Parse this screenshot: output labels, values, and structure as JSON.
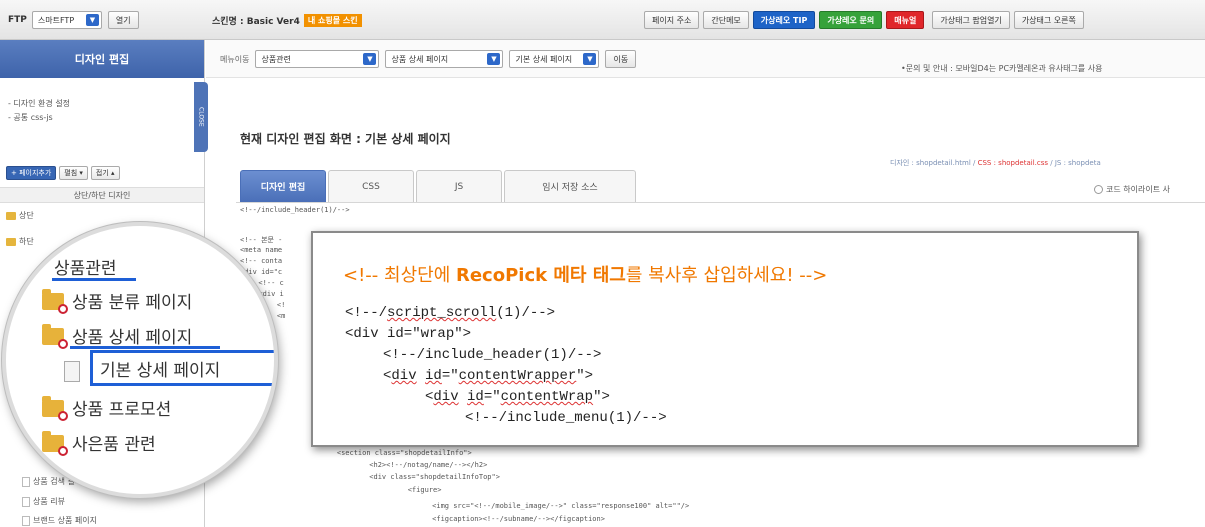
{
  "topbar": {
    "ftp_label": "FTP",
    "ftp_select": "스마트FTP",
    "open_button": "열기",
    "skin_label": "스킨명 : Basic Ver4",
    "skin_badge": "내 쇼핑몰 스킨",
    "buttons": [
      "페이지 주소",
      "간단메모"
    ],
    "tip_button": "가상레오 TIP",
    "inquiry_button": "가상레오 문의",
    "manual_button": "매뉴얼",
    "popup_open_button": "가상태그 팝업열기",
    "right_button": "가상태그 오른쪽"
  },
  "leftpanel": {
    "title": "디자인 편집",
    "links": [
      "- 디자인 환경 설정",
      "- 공통 css-js"
    ],
    "close_tab": "CLOSE",
    "tools": [
      "+ 페이지추가",
      "펼침 ▾",
      "접기 ▴"
    ],
    "section": "상단/하단 디자인",
    "tree": [
      "상단",
      "하단",
      "상품 검색 결과 화면",
      "상품 리뷰",
      "브랜드 상품 페이지"
    ]
  },
  "subbar": {
    "menu_label": "메뉴이동",
    "select1": "상품관련",
    "select2": "상품 상세 페이지",
    "select3": "기본 상세 페이지",
    "move_button": "이동",
    "notice": "•문의 및 안내 : 모바일D4는 PC카멜레온과 유사태그를 사용"
  },
  "main": {
    "heading": "현재 디자인 편집 화면 : 기본 상세 페이지",
    "file_info": {
      "design": "디자인 : shopdetail.html / ",
      "css": "CSS : shopdetail.css",
      "js": " / JS : shopdeta"
    },
    "tabs": [
      "디자인 편집",
      "CSS",
      "JS",
      "임시 저장 소스"
    ],
    "highlight_option": "코드 하이라이트 사",
    "code_lines": [
      "<!--/include_header(1)/-->",
      "<!-- 본문 -",
      "<meta name",
      "<!-- conta",
      "<div id=\"c",
      "  <!-- c",
      "  <div i",
      "    <!",
      "    <m",
      "    <section class=\"shopdetailInfo\">",
      "      <h2><!--/notag/name/--></h2>",
      "      <div class=\"shopdetailInfoTop\">",
      "        <figure>",
      "          <img src=\"<!--/mobile_image/-->\" class=\"response100\" alt=\"\"/>",
      "          <figcaption><!--/subname/--></figcaption>"
    ]
  },
  "popup": {
    "title_prefix": "<!-- 최상단에 ",
    "title_bold": "RecoPick 메타 태그",
    "title_suffix": "를 복사후 삽입하세요! -->",
    "line1_pre": "<!--/",
    "line1_word": "script_scroll",
    "line1_post": "(1)/-->",
    "line2": "<div id=\"wrap\">",
    "line3": "<!--/include_header(1)/-->",
    "line4_pre": "<",
    "line4_w1": "div",
    "line4_mid": " ",
    "line4_w2": "id",
    "line4_post": "=\"",
    "line4_w3": "contentWrapper",
    "line4_end": "\">",
    "line5_pre": "<",
    "line5_w1": "div",
    "line5_mid": " ",
    "line5_w2": "id",
    "line5_post": "=\"",
    "line5_w3": "contentWrap",
    "line5_end": "\">",
    "line6": "<!--/include_menu(1)/-->"
  },
  "magnifier": {
    "category": "상품관련",
    "items": [
      "상품 분류 페이지",
      "상품 상세 페이지",
      "기본 상세 페이지",
      "상품 프로모션",
      "사은품 관련"
    ]
  },
  "colors": {
    "accent_blue": "#3e63aa",
    "popup_orange": "#f07800",
    "tip_blue": "#1d63c7",
    "inquiry_green": "#36a23a",
    "manual_red": "#e0262a"
  }
}
